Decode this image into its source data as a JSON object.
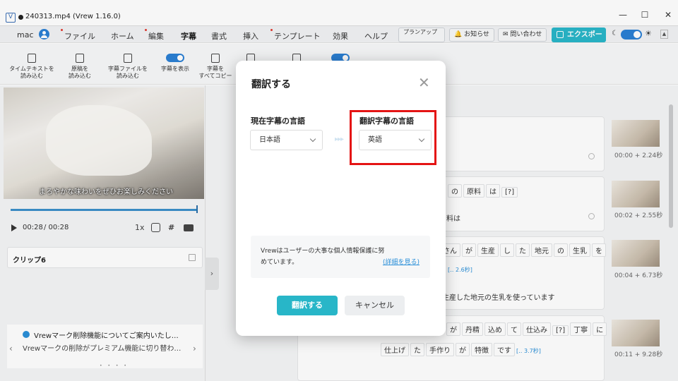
{
  "window": {
    "title": "240313.mp4 (Vrew 1.16.0)",
    "minimize": "—",
    "maximize": "☐",
    "close": "✕"
  },
  "menu": {
    "user": "mac",
    "items": [
      "ファイル",
      "ホーム",
      "編集",
      "字幕",
      "書式",
      "挿入",
      "テンプレート",
      "効果",
      "ヘルプ"
    ],
    "active": "字幕",
    "plan_upgrade": "プランアップ",
    "notifications": "お知らせ",
    "contact": "問い合わせ",
    "export": "エクスポート"
  },
  "toolbar": {
    "import_timed_text": [
      "タイムテキストを",
      "読み込む"
    ],
    "import_script": [
      "原稿を",
      "読み込む"
    ],
    "import_subtitle_file": [
      "字幕ファイルを",
      "読み込む"
    ],
    "show_subtitles": "字幕を表示",
    "copy_all_subtitles": [
      "字幕を",
      "すべてコピー"
    ]
  },
  "player": {
    "subtitle_overlay": "まろやかな味わいをぜひお楽しみください",
    "current_time": "00:28",
    "total_time": "/ 00:28",
    "speed": "1x",
    "progress": 1.0
  },
  "clip": {
    "title": "クリップ6"
  },
  "notice": {
    "title": "Vrewマーク削除機能についてご案内いたし…",
    "body": "Vrewマークの削除がプレミアム機能に切り替わ…",
    "dots": "• • • •"
  },
  "cards": [
    {
      "words": [],
      "sentence": "",
      "thumb_time": "00:00 + 2.24秒"
    },
    {
      "words": [
        "の",
        "原料",
        "は",
        "[?]"
      ],
      "sentence": "料は",
      "thumb_time": "00:02 + 2.55秒"
    },
    {
      "words": [
        "さん",
        "が",
        "生産",
        "し",
        "た",
        "地元",
        "の",
        "生乳",
        "を"
      ],
      "pause": "[‥ 2.6秒]",
      "sentence": "生産した地元の生乳を使っています",
      "thumb_time": "00:04 + 6.73秒"
    },
    {
      "words": [
        "が",
        "丹精",
        "込め",
        "て",
        "仕込み",
        "[?]",
        "丁寧",
        "に"
      ],
      "words2": [
        "仕上げ",
        "た",
        "手作り",
        "が",
        "特徴",
        "です"
      ],
      "pause": "[‥ 3.7秒]",
      "sentence": "",
      "thumb_time": "00:11 + 9.28秒"
    }
  ],
  "modal": {
    "title": "翻訳する",
    "current_lang_label": "現在字幕の言語",
    "current_lang": "日本語",
    "target_lang_label": "翻訳字幕の言語",
    "target_lang": "英語",
    "arrows": "▸▸▸",
    "privacy_text": "Vrewはユーザーの大事な個人情報保護に努めています。",
    "privacy_link": "(詳細を見る)",
    "translate_button": "翻訳する",
    "cancel_button": "キャンセル",
    "close_icon": "✕"
  },
  "colors": {
    "accent": "#28b6c8",
    "brand_blue": "#2a7fd4",
    "highlight_red": "#e41414"
  }
}
